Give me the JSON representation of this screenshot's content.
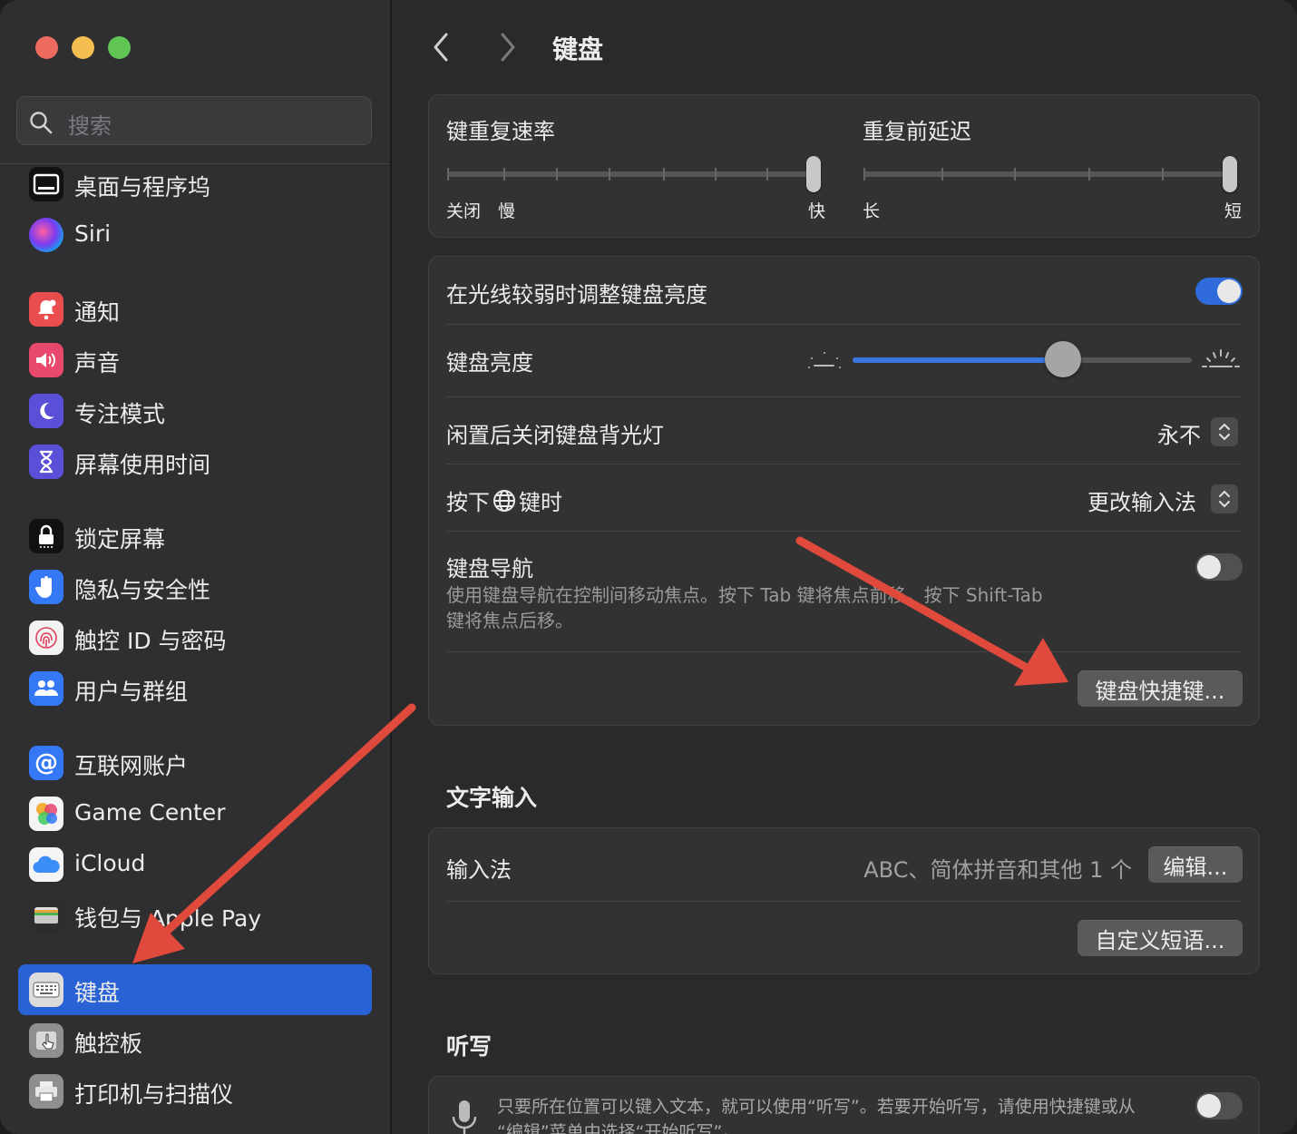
{
  "colors": {
    "accent": "#2962d4",
    "annotation_arrow": "#e04a3c",
    "toggle_on": "#2f6bdb",
    "traffic_red": "#ed6a5e",
    "traffic_yellow": "#f5bf4f",
    "traffic_green": "#61c554"
  },
  "search": {
    "placeholder": "搜索",
    "icon": "magnifier-icon"
  },
  "sidebar": {
    "items": [
      {
        "label": "桌面与程序坞",
        "icon": "dock-icon"
      },
      {
        "label": "Siri",
        "icon": "siri-icon"
      },
      {
        "label": "通知",
        "icon": "bell-icon"
      },
      {
        "label": "声音",
        "icon": "speaker-icon"
      },
      {
        "label": "专注模式",
        "icon": "moon-icon"
      },
      {
        "label": "屏幕使用时间",
        "icon": "hourglass-icon"
      },
      {
        "label": "锁定屏幕",
        "icon": "lock-icon"
      },
      {
        "label": "隐私与安全性",
        "icon": "hand-icon"
      },
      {
        "label": "触控 ID 与密码",
        "icon": "fingerprint-icon"
      },
      {
        "label": "用户与群组",
        "icon": "users-icon"
      },
      {
        "label": "互联网账户",
        "icon": "at-icon"
      },
      {
        "label": "Game Center",
        "icon": "game-center-icon"
      },
      {
        "label": "iCloud",
        "icon": "cloud-icon"
      },
      {
        "label": "钱包与 Apple Pay",
        "icon": "wallet-icon"
      },
      {
        "label": "键盘",
        "icon": "keyboard-icon",
        "selected": true
      },
      {
        "label": "触控板",
        "icon": "trackpad-icon"
      },
      {
        "label": "打印机与扫描仪",
        "icon": "printer-icon"
      }
    ]
  },
  "header": {
    "title": "键盘"
  },
  "repeat_card": {
    "key_repeat": {
      "label": "键重复速率",
      "left_labels": [
        "关闭",
        "慢"
      ],
      "right_label": "快",
      "value_fraction": 1.0
    },
    "delay": {
      "label": "重复前延迟",
      "left_label": "长",
      "right_label": "短",
      "value_fraction": 1.0
    }
  },
  "backlight_card": {
    "adjust_low_light": {
      "label": "在光线较弱时调整键盘亮度",
      "on": true
    },
    "brightness": {
      "label": "键盘亮度",
      "value_fraction": 0.62
    },
    "turn_off": {
      "label": "闲置后关闭键盘背光灯",
      "value": "永不"
    },
    "globe_key": {
      "label_before": "按下",
      "label_after": "键时",
      "value": "更改输入法"
    },
    "keyboard_nav": {
      "label": "键盘导航",
      "on": false,
      "desc_line1": "使用键盘导航在控制间移动焦点。按下 Tab 键将焦点前移，按下 Shift-Tab",
      "desc_line2": "键将焦点后移。"
    },
    "shortcuts_button": "键盘快捷键..."
  },
  "text_input": {
    "heading": "文字输入",
    "input_sources": {
      "label": "输入法",
      "value": "ABC、简体拼音和其他 1 个",
      "edit_button": "编辑..."
    },
    "text_replacements_button": "自定义短语..."
  },
  "dictation": {
    "heading": "听写",
    "desc_line1": "只要所在位置可以键入文本，就可以使用“听写”。若要开始听写，请使用快捷键或从",
    "desc_line2": "“编辑”菜单中选择“开始听写”。",
    "on": false
  }
}
